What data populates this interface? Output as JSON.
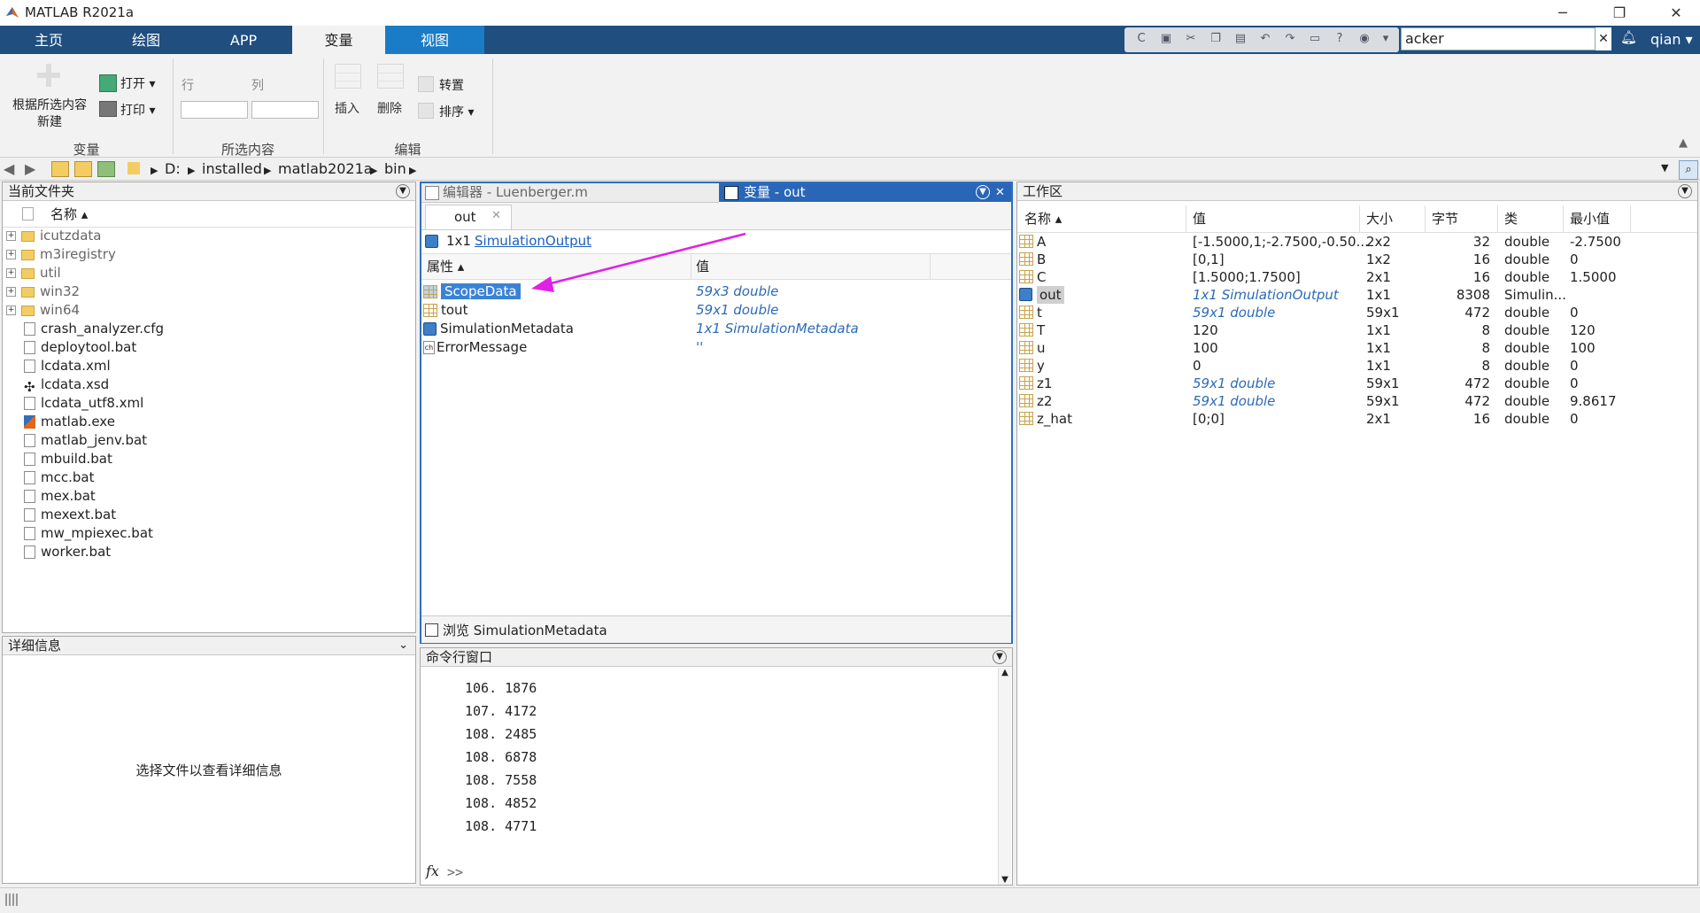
{
  "window": {
    "title": "MATLAB R2021a",
    "min": "─",
    "max": "❐",
    "close": "✕"
  },
  "tabs": [
    "主页",
    "绘图",
    "APP",
    "变量",
    "视图"
  ],
  "search": {
    "value": "acker",
    "clear": "✕"
  },
  "user": "qian ▾",
  "ribbon": {
    "new_from_selection": "根据所选内容\n新建",
    "open": "打开 ▾",
    "print": "打印 ▾",
    "row_label": "行",
    "col_label": "列",
    "insert": "插入",
    "delete": "删除",
    "transpose": "转置",
    "sort": "排序 ▾",
    "sections": [
      "变量",
      "所选内容",
      "编辑"
    ]
  },
  "address": {
    "parts": [
      "D:",
      "installed",
      "matlab2021a",
      "bin"
    ]
  },
  "current_folder": {
    "title": "当前文件夹",
    "col_name": "名称 ▴",
    "folders": [
      "icutzdata",
      "m3iregistry",
      "util",
      "win32",
      "win64"
    ],
    "files": [
      "crash_analyzer.cfg",
      "deploytool.bat",
      "lcdata.xml",
      "lcdata.xsd",
      "lcdata_utf8.xml",
      "matlab.exe",
      "matlab_jenv.bat",
      "mbuild.bat",
      "mcc.bat",
      "mex.bat",
      "mexext.bat",
      "mw_mpiexec.bat",
      "worker.bat"
    ]
  },
  "details": {
    "title": "详细信息",
    "message": "选择文件以查看详细信息"
  },
  "editor": {
    "tab_editor": "编辑器 - Luenberger.m",
    "tab_variable": "变量 - out",
    "doc_tab": "out",
    "summary_size": "1x1",
    "summary_class": "SimulationOutput",
    "col_prop": "属性 ▴",
    "col_val": "值",
    "props": [
      {
        "name": "ScopeData",
        "value": "59x3 double"
      },
      {
        "name": "tout",
        "value": "59x1 double"
      },
      {
        "name": "SimulationMetadata",
        "value": "1x1 SimulationMetadata"
      },
      {
        "name": "ErrorMessage",
        "value": "''"
      }
    ],
    "browse": "浏览 SimulationMetadata"
  },
  "command_window": {
    "title": "命令行窗口",
    "lines": [
      "106. 1876",
      "107. 4172",
      "108. 2485",
      "108. 6878",
      "108. 7558",
      "108. 4852",
      "108. 4771"
    ],
    "prompt": ">>",
    "fx": "fx"
  },
  "workspace": {
    "title": "工作区",
    "columns": [
      "名称 ▴",
      "值",
      "大小",
      "字节",
      "类",
      "最小值"
    ],
    "rows": [
      {
        "name": "A",
        "value": "[-1.5000,1;-2.7500,-0.50...",
        "size": "2x2",
        "bytes": "32",
        "class": "double",
        "min": "-2.7500"
      },
      {
        "name": "B",
        "value": "[0,1]",
        "size": "1x2",
        "bytes": "16",
        "class": "double",
        "min": "0"
      },
      {
        "name": "C",
        "value": "[1.5000;1.7500]",
        "size": "2x1",
        "bytes": "16",
        "class": "double",
        "min": "1.5000"
      },
      {
        "name": "out",
        "value": "1x1 SimulationOutput",
        "size": "1x1",
        "bytes": "8308",
        "class": "Simulin...",
        "min": ""
      },
      {
        "name": "t",
        "value": "59x1 double",
        "size": "59x1",
        "bytes": "472",
        "class": "double",
        "min": "0"
      },
      {
        "name": "T",
        "value": "120",
        "size": "1x1",
        "bytes": "8",
        "class": "double",
        "min": "120"
      },
      {
        "name": "u",
        "value": "100",
        "size": "1x1",
        "bytes": "8",
        "class": "double",
        "min": "100"
      },
      {
        "name": "y",
        "value": "0",
        "size": "1x1",
        "bytes": "8",
        "class": "double",
        "min": "0"
      },
      {
        "name": "z1",
        "value": "59x1 double",
        "size": "59x1",
        "bytes": "472",
        "class": "double",
        "min": "0"
      },
      {
        "name": "z2",
        "value": "59x1 double",
        "size": "59x1",
        "bytes": "472",
        "class": "double",
        "min": "9.8617"
      },
      {
        "name": "z_hat",
        "value": "[0;0]",
        "size": "2x1",
        "bytes": "16",
        "class": "double",
        "min": "0"
      }
    ]
  },
  "colors": {
    "tabstrip": "#1f4e7f",
    "view_tab": "#1a7bc6",
    "selection": "#3b82d6",
    "arrow": "#e020e8"
  }
}
